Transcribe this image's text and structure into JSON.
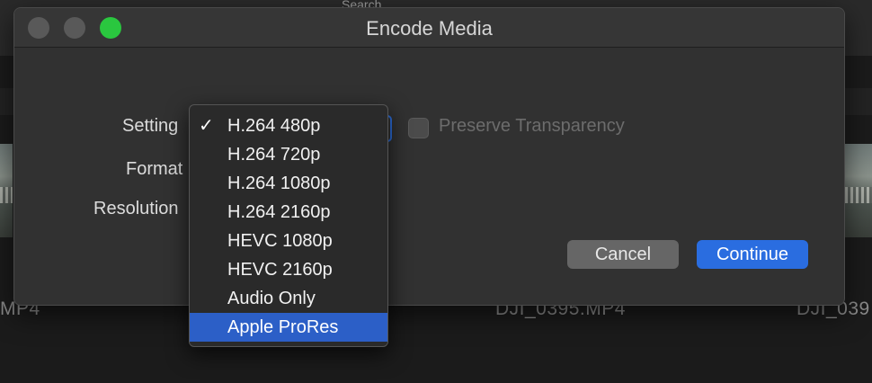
{
  "background": {
    "search_hint": "Search",
    "clips": [
      "MP4",
      "DJI_0395.MP4",
      "DJI_039"
    ]
  },
  "dialog": {
    "title": "Encode Media",
    "labels": {
      "setting": "Setting",
      "format": "Format",
      "resolution": "Resolution"
    },
    "checkbox": {
      "label": "Preserve Transparency",
      "checked": false,
      "enabled": false
    },
    "buttons": {
      "cancel": "Cancel",
      "continue": "Continue"
    }
  },
  "menu": {
    "checkmark": "✓",
    "items": [
      {
        "label": "H.264 480p",
        "checked": true
      },
      {
        "label": "H.264 720p",
        "checked": false
      },
      {
        "label": "H.264 1080p",
        "checked": false
      },
      {
        "label": "H.264 2160p",
        "checked": false
      },
      {
        "label": "HEVC 1080p",
        "checked": false
      },
      {
        "label": "HEVC 2160p",
        "checked": false
      },
      {
        "label": "Audio Only",
        "checked": false
      },
      {
        "label": "Apple ProRes",
        "checked": false,
        "highlighted": true
      }
    ]
  },
  "colors": {
    "accent": "#2a6de0",
    "highlight": "#2c5fc7",
    "zoom_button": "#2ac73f"
  }
}
